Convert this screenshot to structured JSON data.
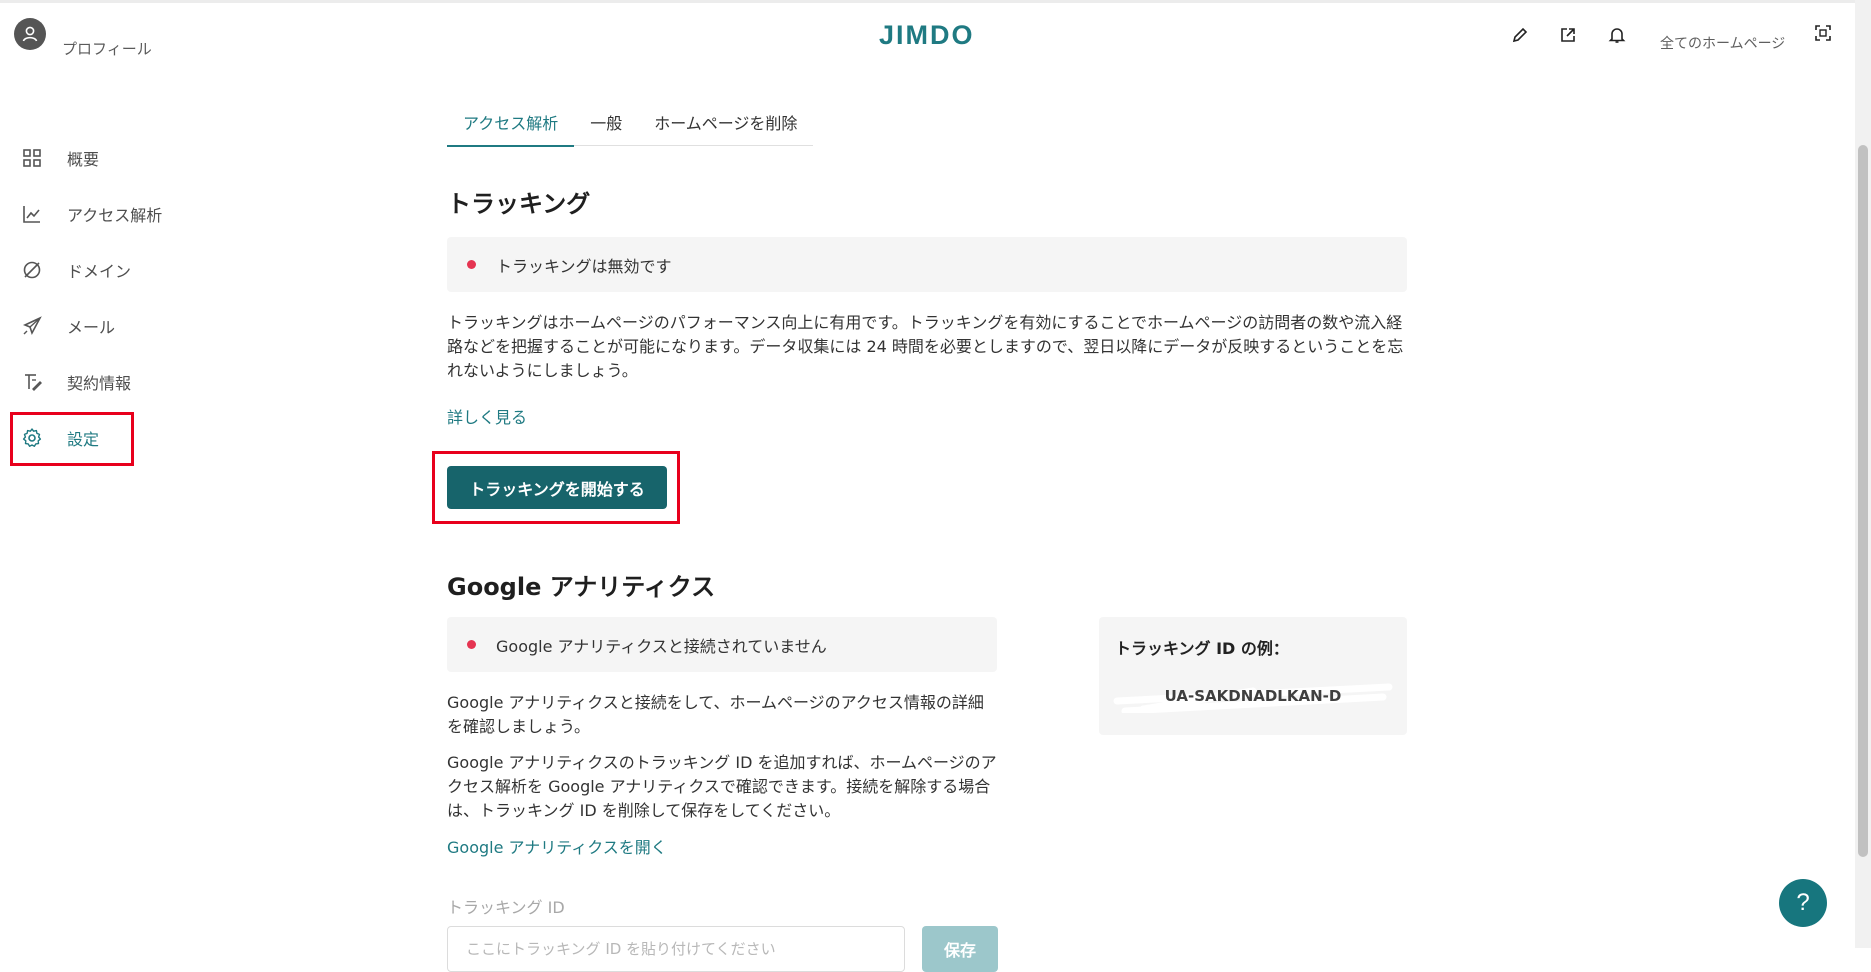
{
  "header": {
    "profile_label": "プロフィール",
    "logo": "JIMDO",
    "all_sites": "全てのホームページ",
    "icons": [
      "pencil-icon",
      "external-link-icon",
      "bell-icon",
      "scan-icon"
    ]
  },
  "sidebar": {
    "items": [
      {
        "label": "概要",
        "icon": "grid-icon"
      },
      {
        "label": "アクセス解析",
        "icon": "analytics-icon"
      },
      {
        "label": "ドメイン",
        "icon": "domain-icon"
      },
      {
        "label": "メール",
        "icon": "paper-plane-icon"
      },
      {
        "label": "契約情報",
        "icon": "contract-icon"
      },
      {
        "label": "設定",
        "icon": "gear-icon",
        "active": true
      }
    ]
  },
  "tabs": [
    {
      "label": "アクセス解析",
      "active": true
    },
    {
      "label": "一般"
    },
    {
      "label": "ホームページを削除"
    }
  ],
  "tracking": {
    "title": "トラッキング",
    "status": "トラッキングは無効です",
    "description": "トラッキングはホームページのパフォーマンス向上に有用です。トラッキングを有効にすることでホームページの訪問者の数や流入経路などを把握することが可能になります。データ収集には 24 時間を必要としますので、翌日以降にデータが反映するということを忘れないようにしましょう。",
    "learn_more": "詳しく見る",
    "start_button": "トラッキングを開始する"
  },
  "google": {
    "title": "Google アナリティクス",
    "status": "Google アナリティクスと接続されていません",
    "desc1": "Google アナリティクスと接続をして、ホームページのアクセス情報の詳細を確認しましょう。",
    "desc2": "Google アナリティクスのトラッキング ID を追加すれば、ホームページのアクセス解析を Google アナリティクスで確認できます。接続を解除する場合は、トラッキング ID を削除して保存をしてください。",
    "open_link": "Google アナリティクスを開く",
    "example_title": "トラッキング ID の例：",
    "example_value": "UA-SAKDNADLKAN-D",
    "field_label": "トラッキング ID",
    "field_placeholder": "ここにトラッキング ID を貼り付けてください",
    "save_button": "保存"
  },
  "help_button": "?",
  "colors": {
    "accent": "#1f7a82",
    "primary_button": "#17646b",
    "status_dot": "#e53451",
    "highlight": "#e8001c"
  }
}
